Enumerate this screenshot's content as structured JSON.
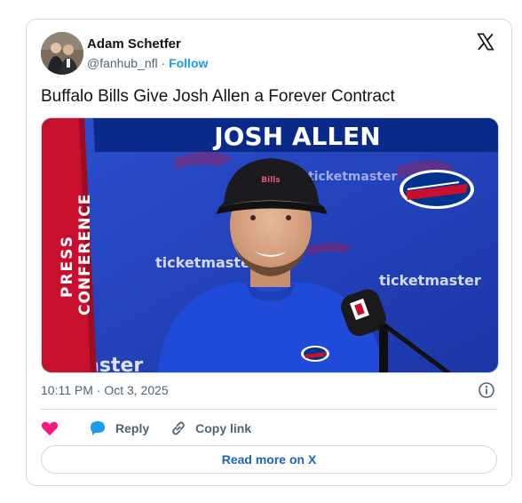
{
  "author": {
    "name": "Adam Schetfer",
    "handle": "@fanhub_nfl",
    "separator": " · ",
    "follow_label": "Follow"
  },
  "tweet": {
    "text": "Buffalo Bills Give Josh Allen a Forever Contract",
    "timestamp": "10:11 PM · Oct 3, 2025"
  },
  "media": {
    "banner_name": "JOSH ALLEN",
    "side_line1": "PRESS",
    "side_line2": "CONFERENCE",
    "backdrop_sponsor": "ticketmaster",
    "colors": {
      "bills_blue": "#1f3fb5",
      "bills_red": "#c8102e",
      "navy": "#0a2a8a"
    }
  },
  "actions": {
    "like_icon": "heart-icon",
    "reply_label": "Reply",
    "copy_link_label": "Copy link"
  },
  "footer": {
    "read_more_label": "Read more on X"
  },
  "colors": {
    "accent": "#1d9bf0",
    "like": "#f91880",
    "link": "#1d63b8",
    "muted": "#536471"
  }
}
